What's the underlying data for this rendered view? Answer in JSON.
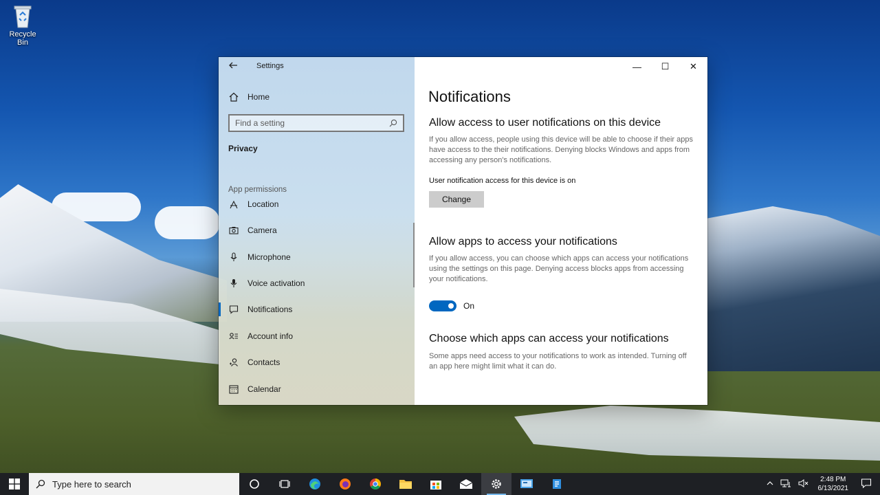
{
  "desktop": {
    "recycle_bin_label": "Recycle Bin"
  },
  "window": {
    "title": "Settings",
    "caption": {
      "minimize": "—",
      "maximize": "☐",
      "close": "✕"
    }
  },
  "sidebar": {
    "home_label": "Home",
    "search_placeholder": "Find a setting",
    "section": "Privacy",
    "group_label": "App permissions",
    "items": [
      {
        "label": "Location",
        "icon": "location-icon"
      },
      {
        "label": "Camera",
        "icon": "camera-icon"
      },
      {
        "label": "Microphone",
        "icon": "microphone-icon"
      },
      {
        "label": "Voice activation",
        "icon": "voice-activation-icon"
      },
      {
        "label": "Notifications",
        "icon": "notifications-icon",
        "selected": true
      },
      {
        "label": "Account info",
        "icon": "account-info-icon"
      },
      {
        "label": "Contacts",
        "icon": "contacts-icon"
      },
      {
        "label": "Calendar",
        "icon": "calendar-icon"
      }
    ]
  },
  "content": {
    "page_title": "Notifications",
    "section1": {
      "heading": "Allow access to user notifications on this device",
      "description": "If you allow access, people using this device will be able to choose if their apps have access to the their notifications. Denying blocks Windows and apps from accessing any person's notifications.",
      "status": "User notification access for this device is on",
      "button": "Change"
    },
    "section2": {
      "heading": "Allow apps to access your notifications",
      "description": "If you allow access, you can choose which apps can access your notifications using the settings on this page. Denying access blocks apps from accessing your notifications.",
      "toggle_state": "On"
    },
    "section3": {
      "heading": "Choose which apps can access your notifications",
      "description": "Some apps need access to your notifications to work as intended. Turning off an app here might limit what it can do."
    }
  },
  "taskbar": {
    "search_placeholder": "Type here to search",
    "apps": [
      "cortana-icon",
      "task-view-icon",
      "edge-icon",
      "firefox-icon",
      "chrome-icon",
      "file-explorer-icon",
      "store-icon",
      "mail-icon",
      "settings-icon",
      "control-panel-icon",
      "network-app-icon"
    ],
    "time": "2:48 PM",
    "date": "6/13/2021"
  },
  "colors": {
    "accent": "#0067c0",
    "taskbar": "#1e2024"
  }
}
